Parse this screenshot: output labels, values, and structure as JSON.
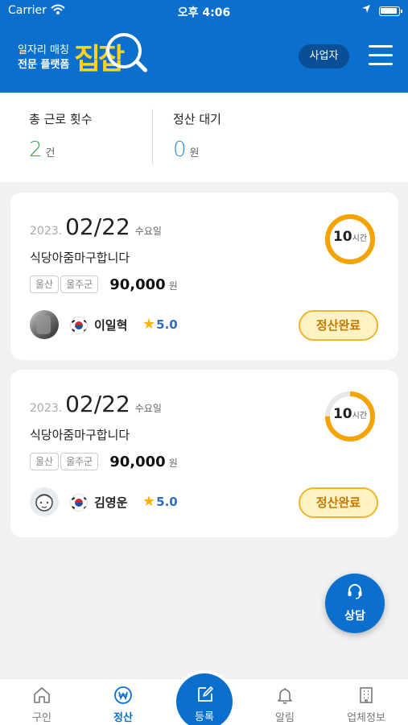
{
  "status_bar": {
    "carrier": "Carrier",
    "time": "오후 4:06"
  },
  "header": {
    "tagline_line1": "일자리 매칭",
    "tagline_line2": "전문 플랫폼",
    "logo_text": "집잡",
    "business_button": "사업자",
    "menu_icon": "hamburger-icon",
    "brand_color": "#0b6fce",
    "logo_color": "#ffd21e"
  },
  "summary": {
    "work_count": {
      "label": "총 근로 횟수",
      "value": "2",
      "unit": "건",
      "color": "#2eaa4a"
    },
    "settlement_pending": {
      "label": "정산 대기",
      "value": "0",
      "unit": "원",
      "color": "#2f8fe0"
    }
  },
  "jobs": [
    {
      "year": "2023.",
      "date": "02/22",
      "weekday": "수요일",
      "title": "식당아줌마구합니다",
      "tags": [
        "울산",
        "울주군"
      ],
      "wage": "90,000",
      "wage_unit": "원",
      "hours": "10",
      "hours_unit": "시간",
      "hours_progress": 1.0,
      "worker": {
        "name": "이일혁",
        "rating": "5.0",
        "nationality_icon": "korea-flag-icon"
      },
      "status_label": "정산완료"
    },
    {
      "year": "2023.",
      "date": "02/22",
      "weekday": "수요일",
      "title": "식당아줌마구합니다",
      "tags": [
        "울산",
        "울주군"
      ],
      "wage": "90,000",
      "wage_unit": "원",
      "hours": "10",
      "hours_unit": "시간",
      "hours_progress": 0.75,
      "worker": {
        "name": "김영운",
        "rating": "5.0",
        "nationality_icon": "korea-flag-icon"
      },
      "status_label": "정산완료"
    }
  ],
  "fab": {
    "label": "상담",
    "icon": "headset-icon"
  },
  "bottom_nav": {
    "items": [
      {
        "label": "구인",
        "icon": "home-icon"
      },
      {
        "label": "정산",
        "icon": "won-coin-icon",
        "active": true
      },
      {
        "label": "등록",
        "icon": "edit-icon"
      },
      {
        "label": "알림",
        "icon": "bell-icon"
      },
      {
        "label": "업체정보",
        "icon": "building-icon"
      }
    ]
  },
  "colors": {
    "status_badge_bg": "#fff3c4",
    "status_badge_border": "#f0b429",
    "ring_color": "#f5a300",
    "rating_color": "#2f6cc6"
  }
}
